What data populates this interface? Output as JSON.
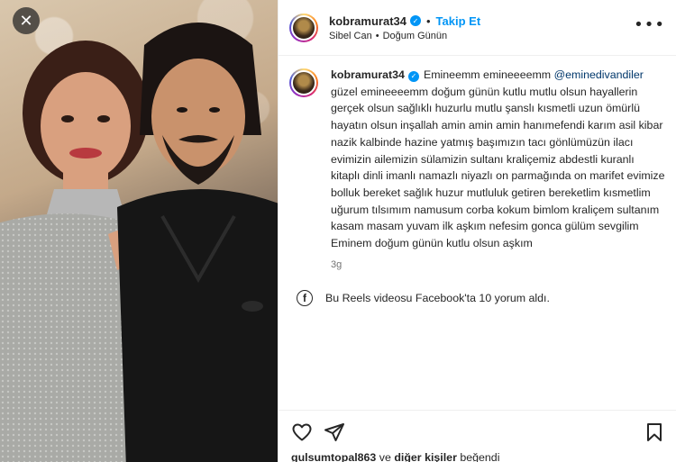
{
  "media": {
    "close_label": "✕"
  },
  "header": {
    "username": "kobramurat34",
    "follow_label": "Takip Et",
    "audio": "Sibel Can",
    "audio_track": "Doğum Günün",
    "more_label": "•••"
  },
  "caption": {
    "username": "kobramurat34",
    "text_start": "Emineemm emineeeemm ",
    "mention": "@eminedivandiler",
    "text_rest": " güzel emineeeemm doğum günün kutlu mutlu olsun hayallerin gerçek olsun sağlıklı huzurlu mutlu şanslı kısmetli uzun ömürlü hayatın olsun inşallah amin amin amin hanımefendi karım asil kibar nazik kalbinde hazine yatmış başımızın tacı gönlümüzün ilacı evimizin ailemizin sülamizin sultanı kraliçemiz abdestli kuranlı kitaplı dinli imanlı namazlı niyazlı on parmağında on marifet evimize bolluk bereket sağlık huzur mutluluk getiren bereketlim kısmetlim uğurum tılsımım namusum corba kokum bimlom kraliçem sultanım kasam masam yuvam ilk aşkım nefesim gonca gülüm sevgilim Eminem doğum günün kutlu olsun aşkım",
    "time": "3g"
  },
  "facebook": {
    "text": "Bu Reels videosu Facebook'ta 10 yorum aldı."
  },
  "likes": {
    "user": "gulsumtopal863",
    "and": "ve",
    "others": "diğer kişiler",
    "liked": "beğendi"
  },
  "colors": {
    "accent": "#0095f6",
    "mention": "#00376b",
    "muted": "#737373"
  }
}
